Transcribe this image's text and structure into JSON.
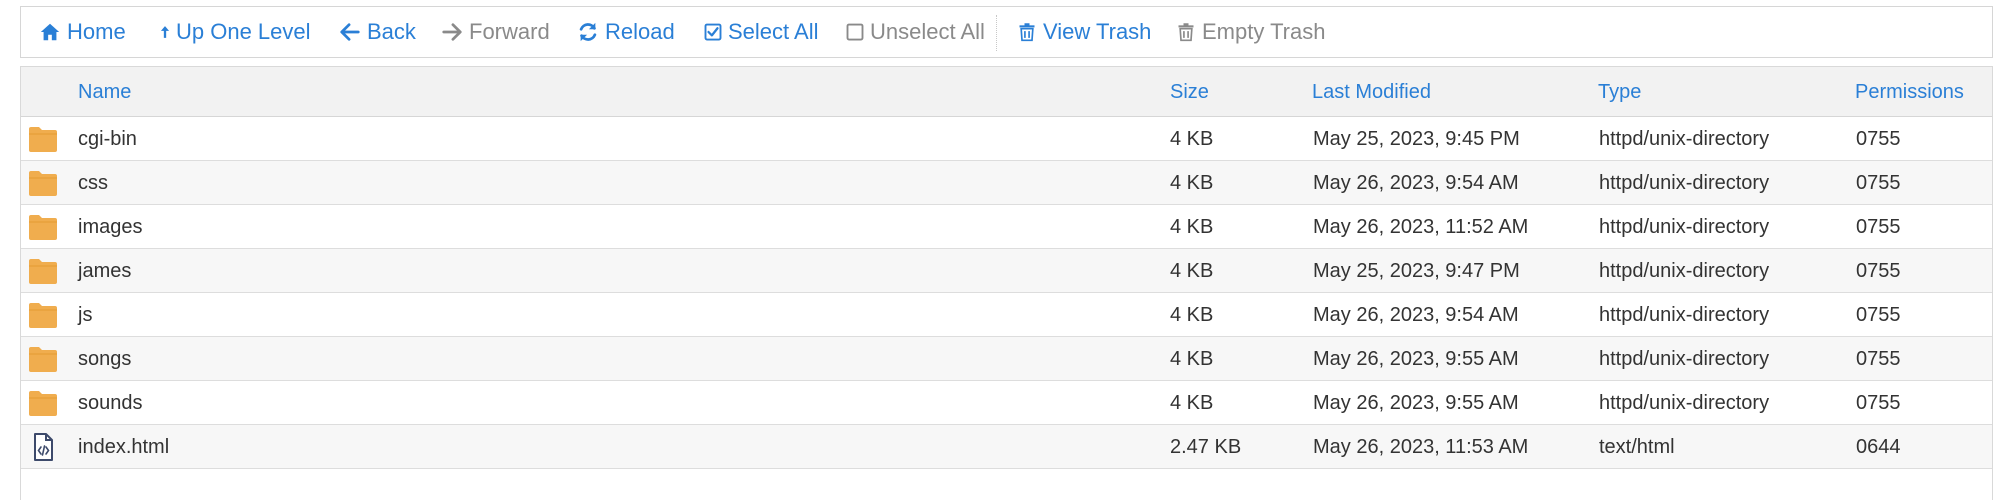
{
  "toolbar": {
    "home": "Home",
    "up": "Up One Level",
    "back": "Back",
    "forward": "Forward",
    "reload": "Reload",
    "select_all": "Select All",
    "unselect_all": "Unselect All",
    "view_trash": "View Trash",
    "empty_trash": "Empty Trash"
  },
  "table": {
    "headers": {
      "name": "Name",
      "size": "Size",
      "modified": "Last Modified",
      "type": "Type",
      "permissions": "Permissions"
    },
    "rows": [
      {
        "icon": "folder-icon",
        "name": "cgi-bin",
        "size": "4 KB",
        "modified": "May 25, 2023, 9:45 PM",
        "type": "httpd/unix-directory",
        "perm": "0755"
      },
      {
        "icon": "folder-icon",
        "name": "css",
        "size": "4 KB",
        "modified": "May 26, 2023, 9:54 AM",
        "type": "httpd/unix-directory",
        "perm": "0755"
      },
      {
        "icon": "folder-icon",
        "name": "images",
        "size": "4 KB",
        "modified": "May 26, 2023, 11:52 AM",
        "type": "httpd/unix-directory",
        "perm": "0755"
      },
      {
        "icon": "folder-icon",
        "name": "james",
        "size": "4 KB",
        "modified": "May 25, 2023, 9:47 PM",
        "type": "httpd/unix-directory",
        "perm": "0755"
      },
      {
        "icon": "folder-icon",
        "name": "js",
        "size": "4 KB",
        "modified": "May 26, 2023, 9:54 AM",
        "type": "httpd/unix-directory",
        "perm": "0755"
      },
      {
        "icon": "folder-icon",
        "name": "songs",
        "size": "4 KB",
        "modified": "May 26, 2023, 9:55 AM",
        "type": "httpd/unix-directory",
        "perm": "0755"
      },
      {
        "icon": "folder-icon",
        "name": "sounds",
        "size": "4 KB",
        "modified": "May 26, 2023, 9:55 AM",
        "type": "httpd/unix-directory",
        "perm": "0755"
      },
      {
        "icon": "code-file-icon",
        "name": "index.html",
        "size": "2.47 KB",
        "modified": "May 26, 2023, 11:53 AM",
        "type": "text/html",
        "perm": "0644"
      }
    ]
  },
  "colors": {
    "accent": "#2a7fd6",
    "disabled": "#8a8a8a",
    "folder": "#f0ad4e",
    "file_icon": "#3d4a6b",
    "header_bg": "#f2f2f2",
    "row_alt_bg": "#f7f7f7"
  }
}
